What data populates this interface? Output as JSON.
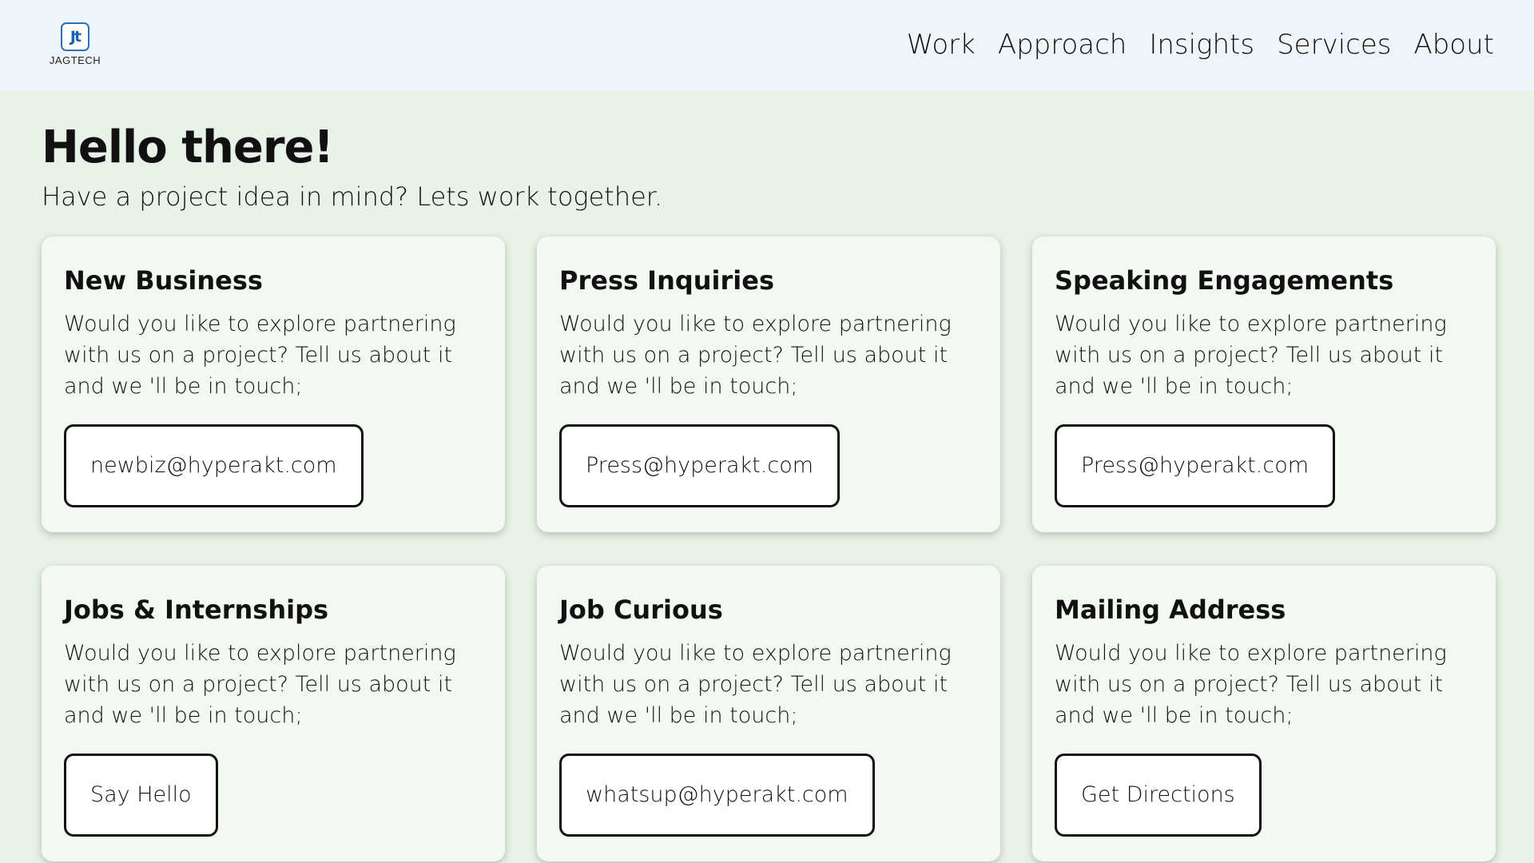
{
  "header": {
    "logo_text": "JAGTECH",
    "logo_mark": "Jt",
    "nav": [
      "Work",
      "Approach",
      "Insights",
      "Services",
      "About"
    ]
  },
  "intro": {
    "title": "Hello there!",
    "subtitle": "Have a project idea in mind? Lets work together."
  },
  "cards": [
    {
      "title": "New Business",
      "text": "Would you like to explore partnering with us on a project? Tell us about it and we 'll be in touch;",
      "button": "newbiz@hyperakt.com"
    },
    {
      "title": "Press Inquiries",
      "text": "Would you like to explore partnering with us on a project? Tell us about it and we 'll be in touch;",
      "button": "Press@hyperakt.com"
    },
    {
      "title": "Speaking Engagements",
      "text": "Would you like to explore partnering with us on a project? Tell us about it and we 'll be in touch;",
      "button": "Press@hyperakt.com"
    },
    {
      "title": "Jobs & Internships",
      "text": "Would you like to explore partnering with us on a project? Tell us about it and we 'll be in touch;",
      "button": "Say Hello"
    },
    {
      "title": "Job Curious",
      "text": "Would you like to explore partnering with us on a project? Tell us about it and we 'll be in touch;",
      "button": "whatsup@hyperakt.com"
    },
    {
      "title": "Mailing Address",
      "text": "Would you like to explore partnering with us on a project? Tell us about it and we 'll be in touch;",
      "button": "Get Directions"
    }
  ]
}
